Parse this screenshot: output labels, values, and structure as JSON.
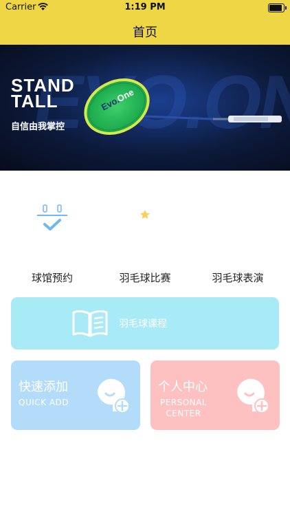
{
  "status": {
    "carrier": "Carrier",
    "time": "1:19 PM"
  },
  "nav": {
    "title": "首页"
  },
  "banner": {
    "bg_text": "EVO.ONE",
    "line1": "STAND",
    "line2": "TALL",
    "tagline": "自信由我掌控",
    "brand_left": "Evo.",
    "brand_right": "One"
  },
  "tiles": [
    {
      "label": "球馆预约",
      "color": "#70b6f6",
      "icon": "calendar-check-icon"
    },
    {
      "label": "羽毛球比赛",
      "color": "#fbcf5f",
      "icon": "trophy-icon"
    },
    {
      "label": "羽毛球表演",
      "color": "#3fd36d",
      "icon": "flag-icon"
    }
  ],
  "course": {
    "label": "羽毛球课程",
    "color": "#a9eaf7",
    "icon": "book-icon"
  },
  "cards": [
    {
      "title": "快速添加",
      "subtitle": "QUICK ADD",
      "color": "#b2dcfa",
      "icon": "user-add-icon"
    },
    {
      "title": "个人中心",
      "subtitle_line1": "PERSONAL",
      "subtitle_line2": "CENTER",
      "color": "#fec1c1",
      "icon": "user-add-icon"
    }
  ]
}
